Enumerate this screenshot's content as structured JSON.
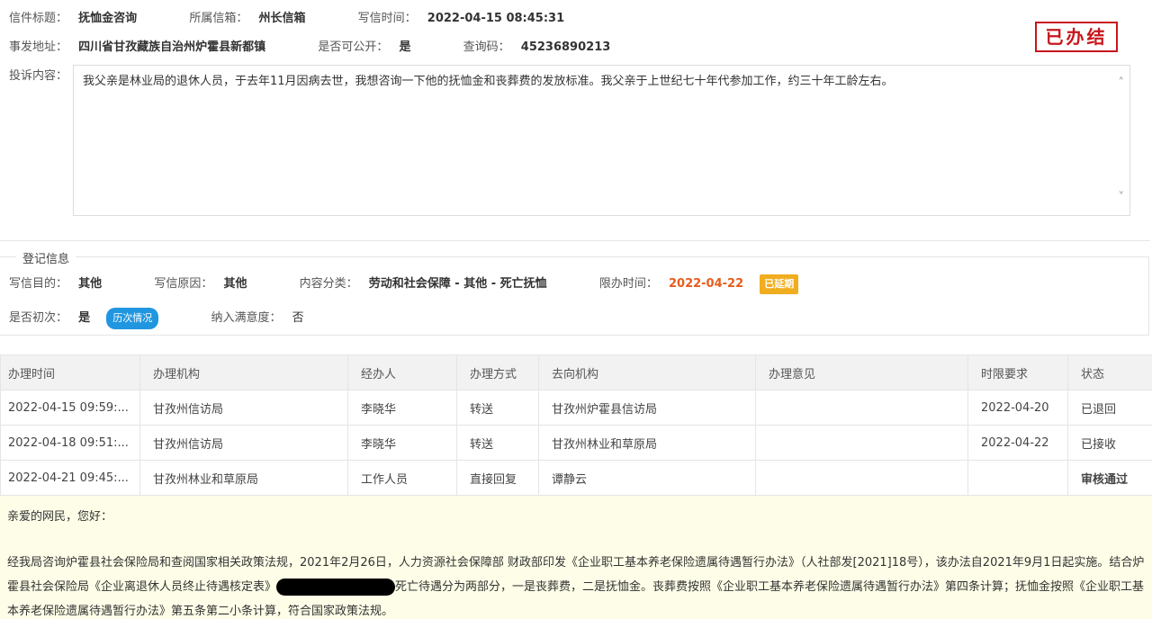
{
  "header": {
    "title_label": "信件标题：",
    "title": "抚恤金咨询",
    "mailbox_label": "所属信箱：",
    "mailbox": "州长信箱",
    "time_label": "写信时间：",
    "time": "2022-04-15 08:45:31",
    "address_label": "事发地址：",
    "address": "四川省甘孜藏族自治州炉霍县新都镇",
    "public_label": "是否可公开：",
    "public": "是",
    "code_label": "查询码：",
    "code": "45236890213",
    "stamp": "已办结"
  },
  "complaint": {
    "label": "投诉内容：",
    "text": "我父亲是林业局的退休人员，于去年11月因病去世，我想咨询一下他的抚恤金和丧葬费的发放标准。我父亲于上世纪七十年代参加工作，约三十年工龄左右。"
  },
  "registration": {
    "legend": "登记信息",
    "purpose_label": "写信目的：",
    "purpose": "其他",
    "reason_label": "写信原因：",
    "reason": "其他",
    "category_label": "内容分类：",
    "category": "劳动和社会保障 - 其他 - 死亡抚恤",
    "deadline_label": "限办时间：",
    "deadline": "2022-04-22",
    "extended_badge": "已延期",
    "first_label": "是否初次：",
    "first": "是",
    "history_badge": "历次情况",
    "satisfaction_label": "纳入满意度：",
    "satisfaction": "否"
  },
  "process_table": {
    "headers": [
      "办理时间",
      "办理机构",
      "经办人",
      "办理方式",
      "去向机构",
      "办理意见",
      "时限要求",
      "状态"
    ],
    "rows": [
      [
        "2022-04-15 09:59:...",
        "甘孜州信访局",
        "李晓华",
        "转送",
        "甘孜州炉霍县信访局",
        "",
        "2022-04-20",
        "已退回"
      ],
      [
        "2022-04-18 09:51:...",
        "甘孜州信访局",
        "李晓华",
        "转送",
        "甘孜州林业和草原局",
        "",
        "2022-04-22",
        "已接收"
      ],
      [
        "2022-04-21 09:45:...",
        "甘孜州林业和草原局",
        "工作人员",
        "直接回复",
        "谭静云",
        "",
        "",
        "审核通过"
      ]
    ]
  },
  "reply": {
    "greeting": "亲爱的网民，您好：",
    "para_a": "经我局咨询炉霍县社会保险局和查阅国家相关政策法规，2021年2月26日，人力资源社会保障部 财政部印发《企业职工基本养老保险遗属待遇暂行办法》（人社部发[2021]18号），该办法自2021年9月1日起实施。结合炉霍县社会保险局《企业离退休人员终止待遇核定表》",
    "para_b": "死亡待遇分为两部分，一是丧葬费，二是抚恤金。丧葬费按照《企业职工基本养老保险遗属待遇暂行办法》第四条计算；抚恤金按照《企业职工基本养老保险遗属待遇暂行办法》第五条第二小条计算，符合国家政策法规。"
  },
  "colors": {
    "stamp": "#c8161d",
    "deadline": "#e85c1c",
    "extended": "#f0ad1f",
    "history": "#2196e0",
    "received": "#2aa836",
    "approved": "#1e88d8",
    "reply_bg": "#fefee8"
  }
}
